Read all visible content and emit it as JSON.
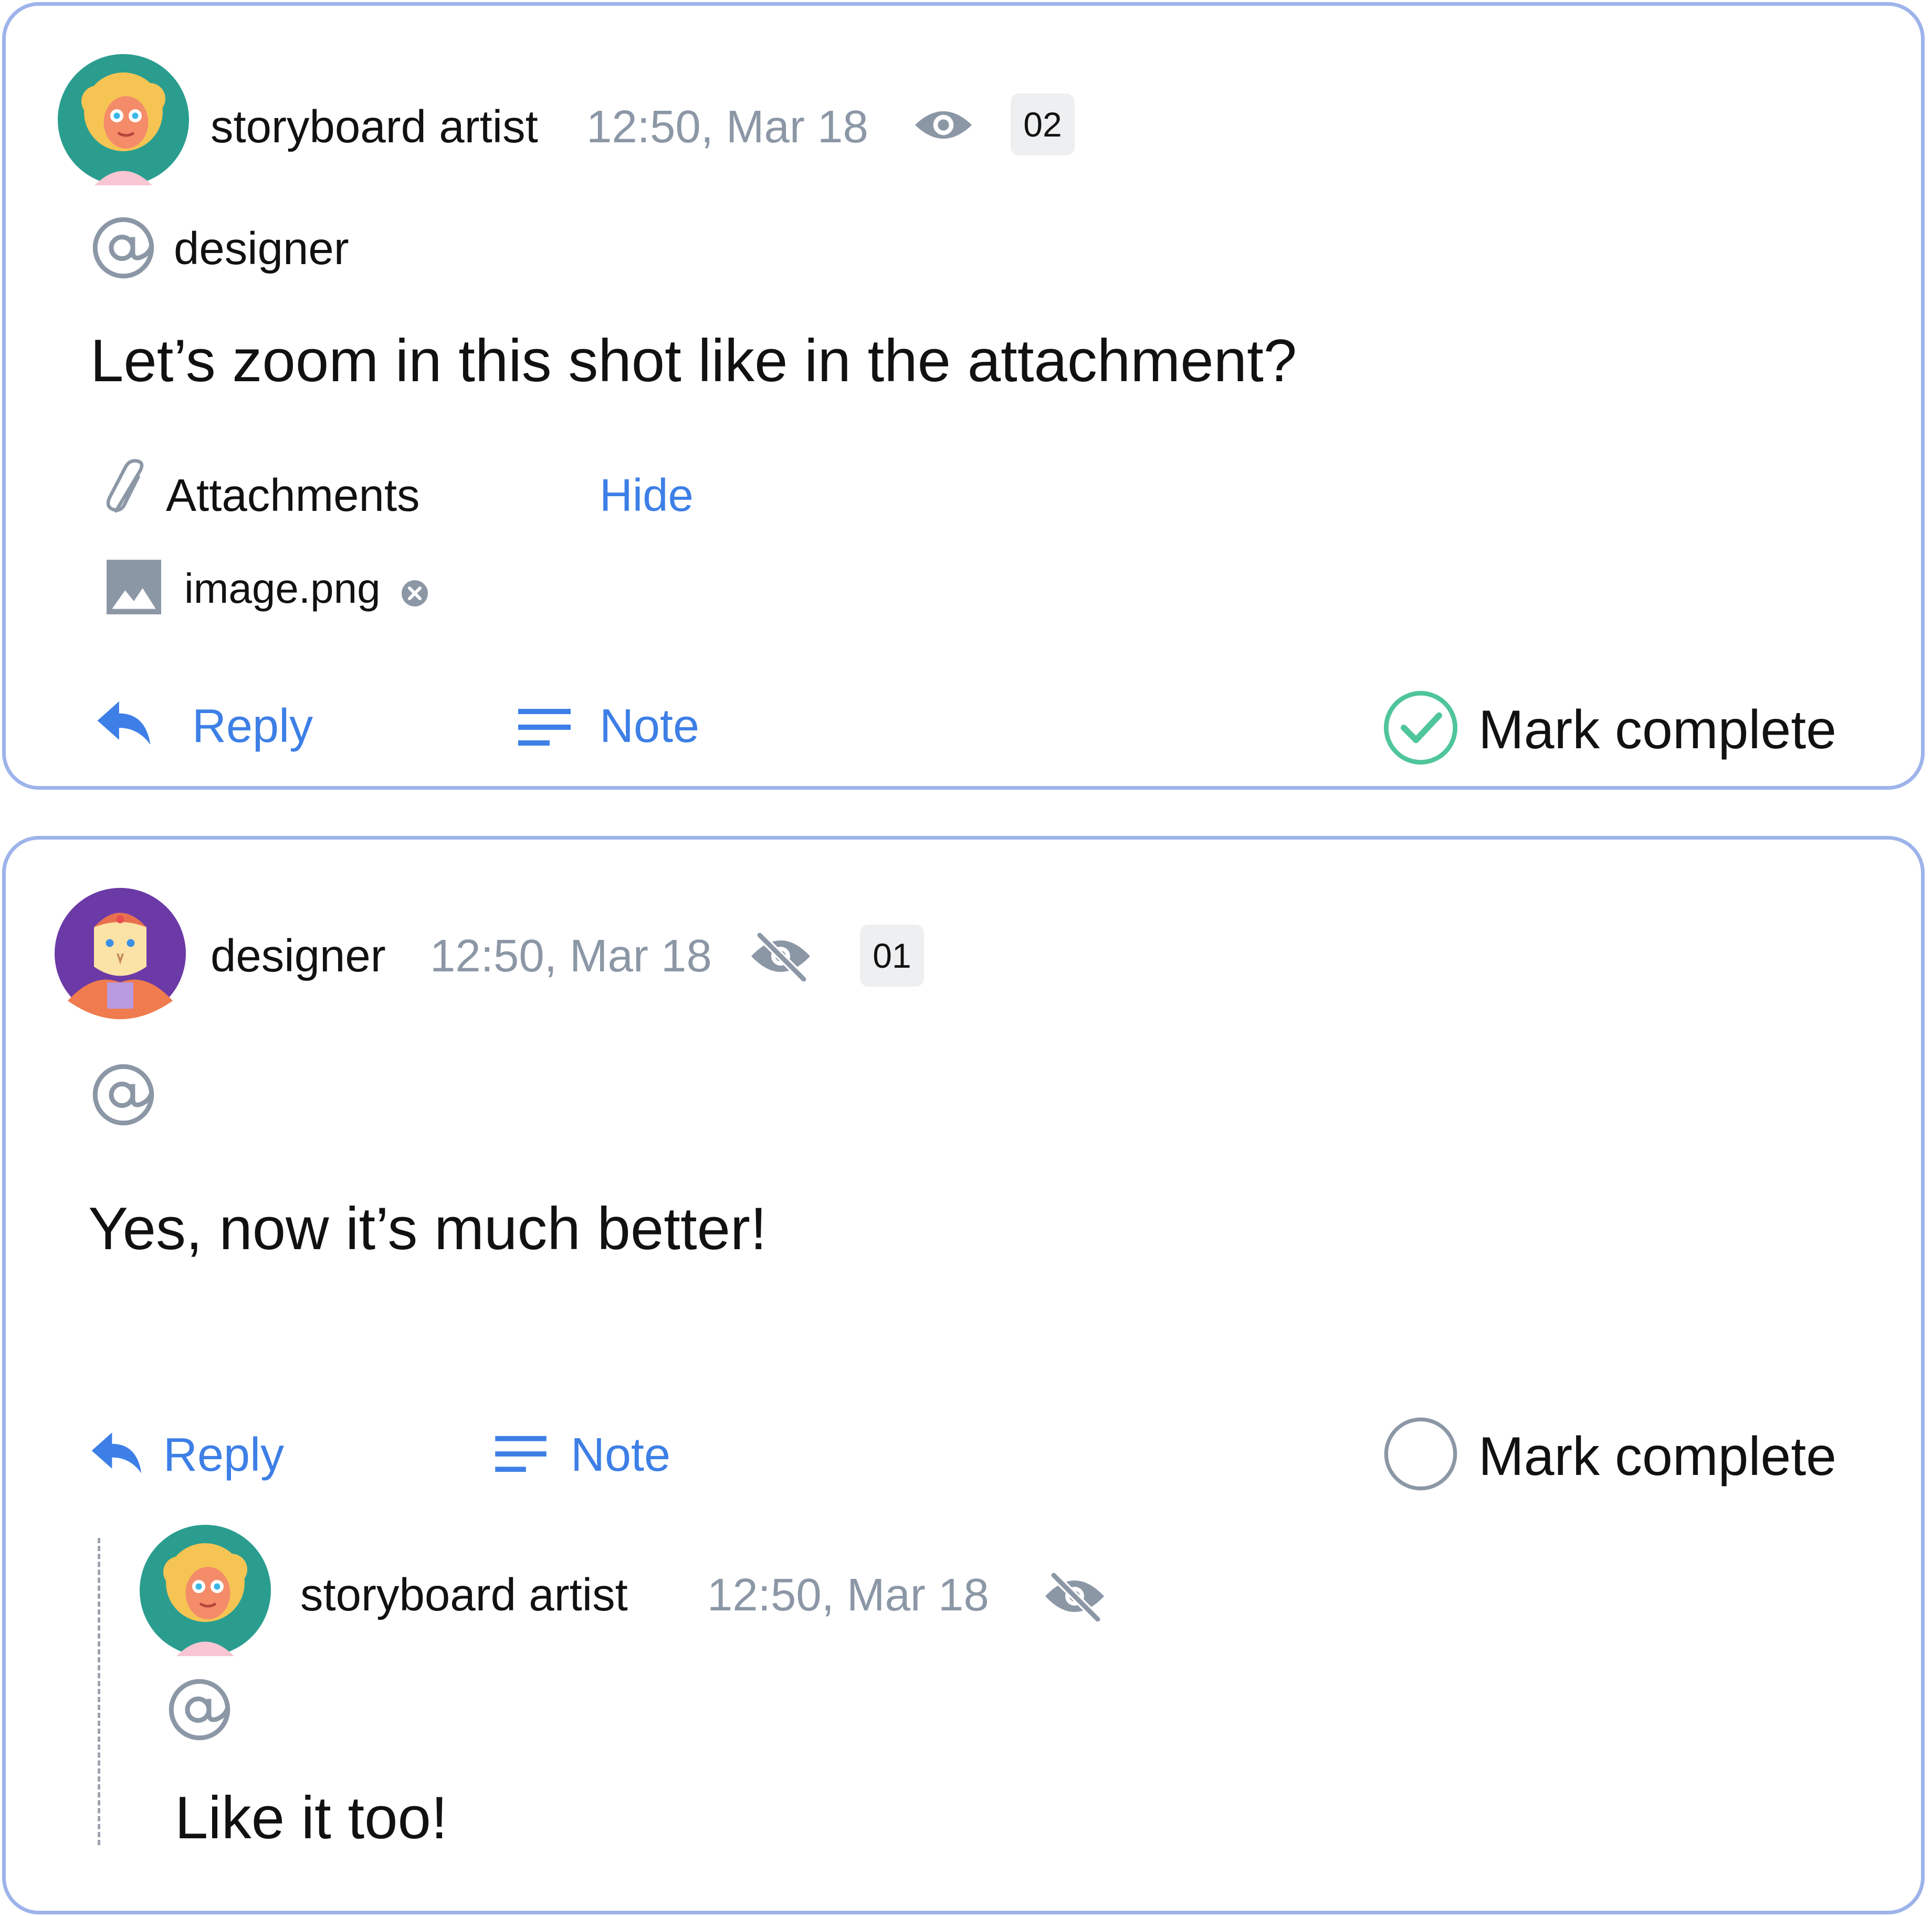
{
  "comments": [
    {
      "author": "storyboard artist",
      "time": "12:50, Mar 18",
      "visibility_icon": "eye-icon",
      "badge": "02",
      "mention": "designer",
      "message": "Let’s zoom in this shot like in the attachment?",
      "attachments": {
        "label": "Attachments",
        "toggle_label": "Hide",
        "files": [
          {
            "name": "image.png"
          }
        ]
      },
      "actions": {
        "reply_label": "Reply",
        "note_label": "Note",
        "complete_label": "Mark complete",
        "completed": true
      }
    },
    {
      "author": "designer",
      "time": "12:50, Mar 18",
      "visibility_icon": "eye-off-icon",
      "badge": "01",
      "mention": "",
      "message": "Yes, now it’s much better!",
      "actions": {
        "reply_label": "Reply",
        "note_label": "Note",
        "complete_label": "Mark complete",
        "completed": false
      },
      "replies": [
        {
          "author": "storyboard artist",
          "time": "12:50, Mar 18",
          "visibility_icon": "eye-off-icon",
          "mention": "",
          "message": "Like it too!"
        }
      ]
    }
  ],
  "colors": {
    "accent": "#3d7fe6",
    "card_border": "#9db3ea",
    "muted": "#8c97a6",
    "success": "#4fc59a"
  }
}
